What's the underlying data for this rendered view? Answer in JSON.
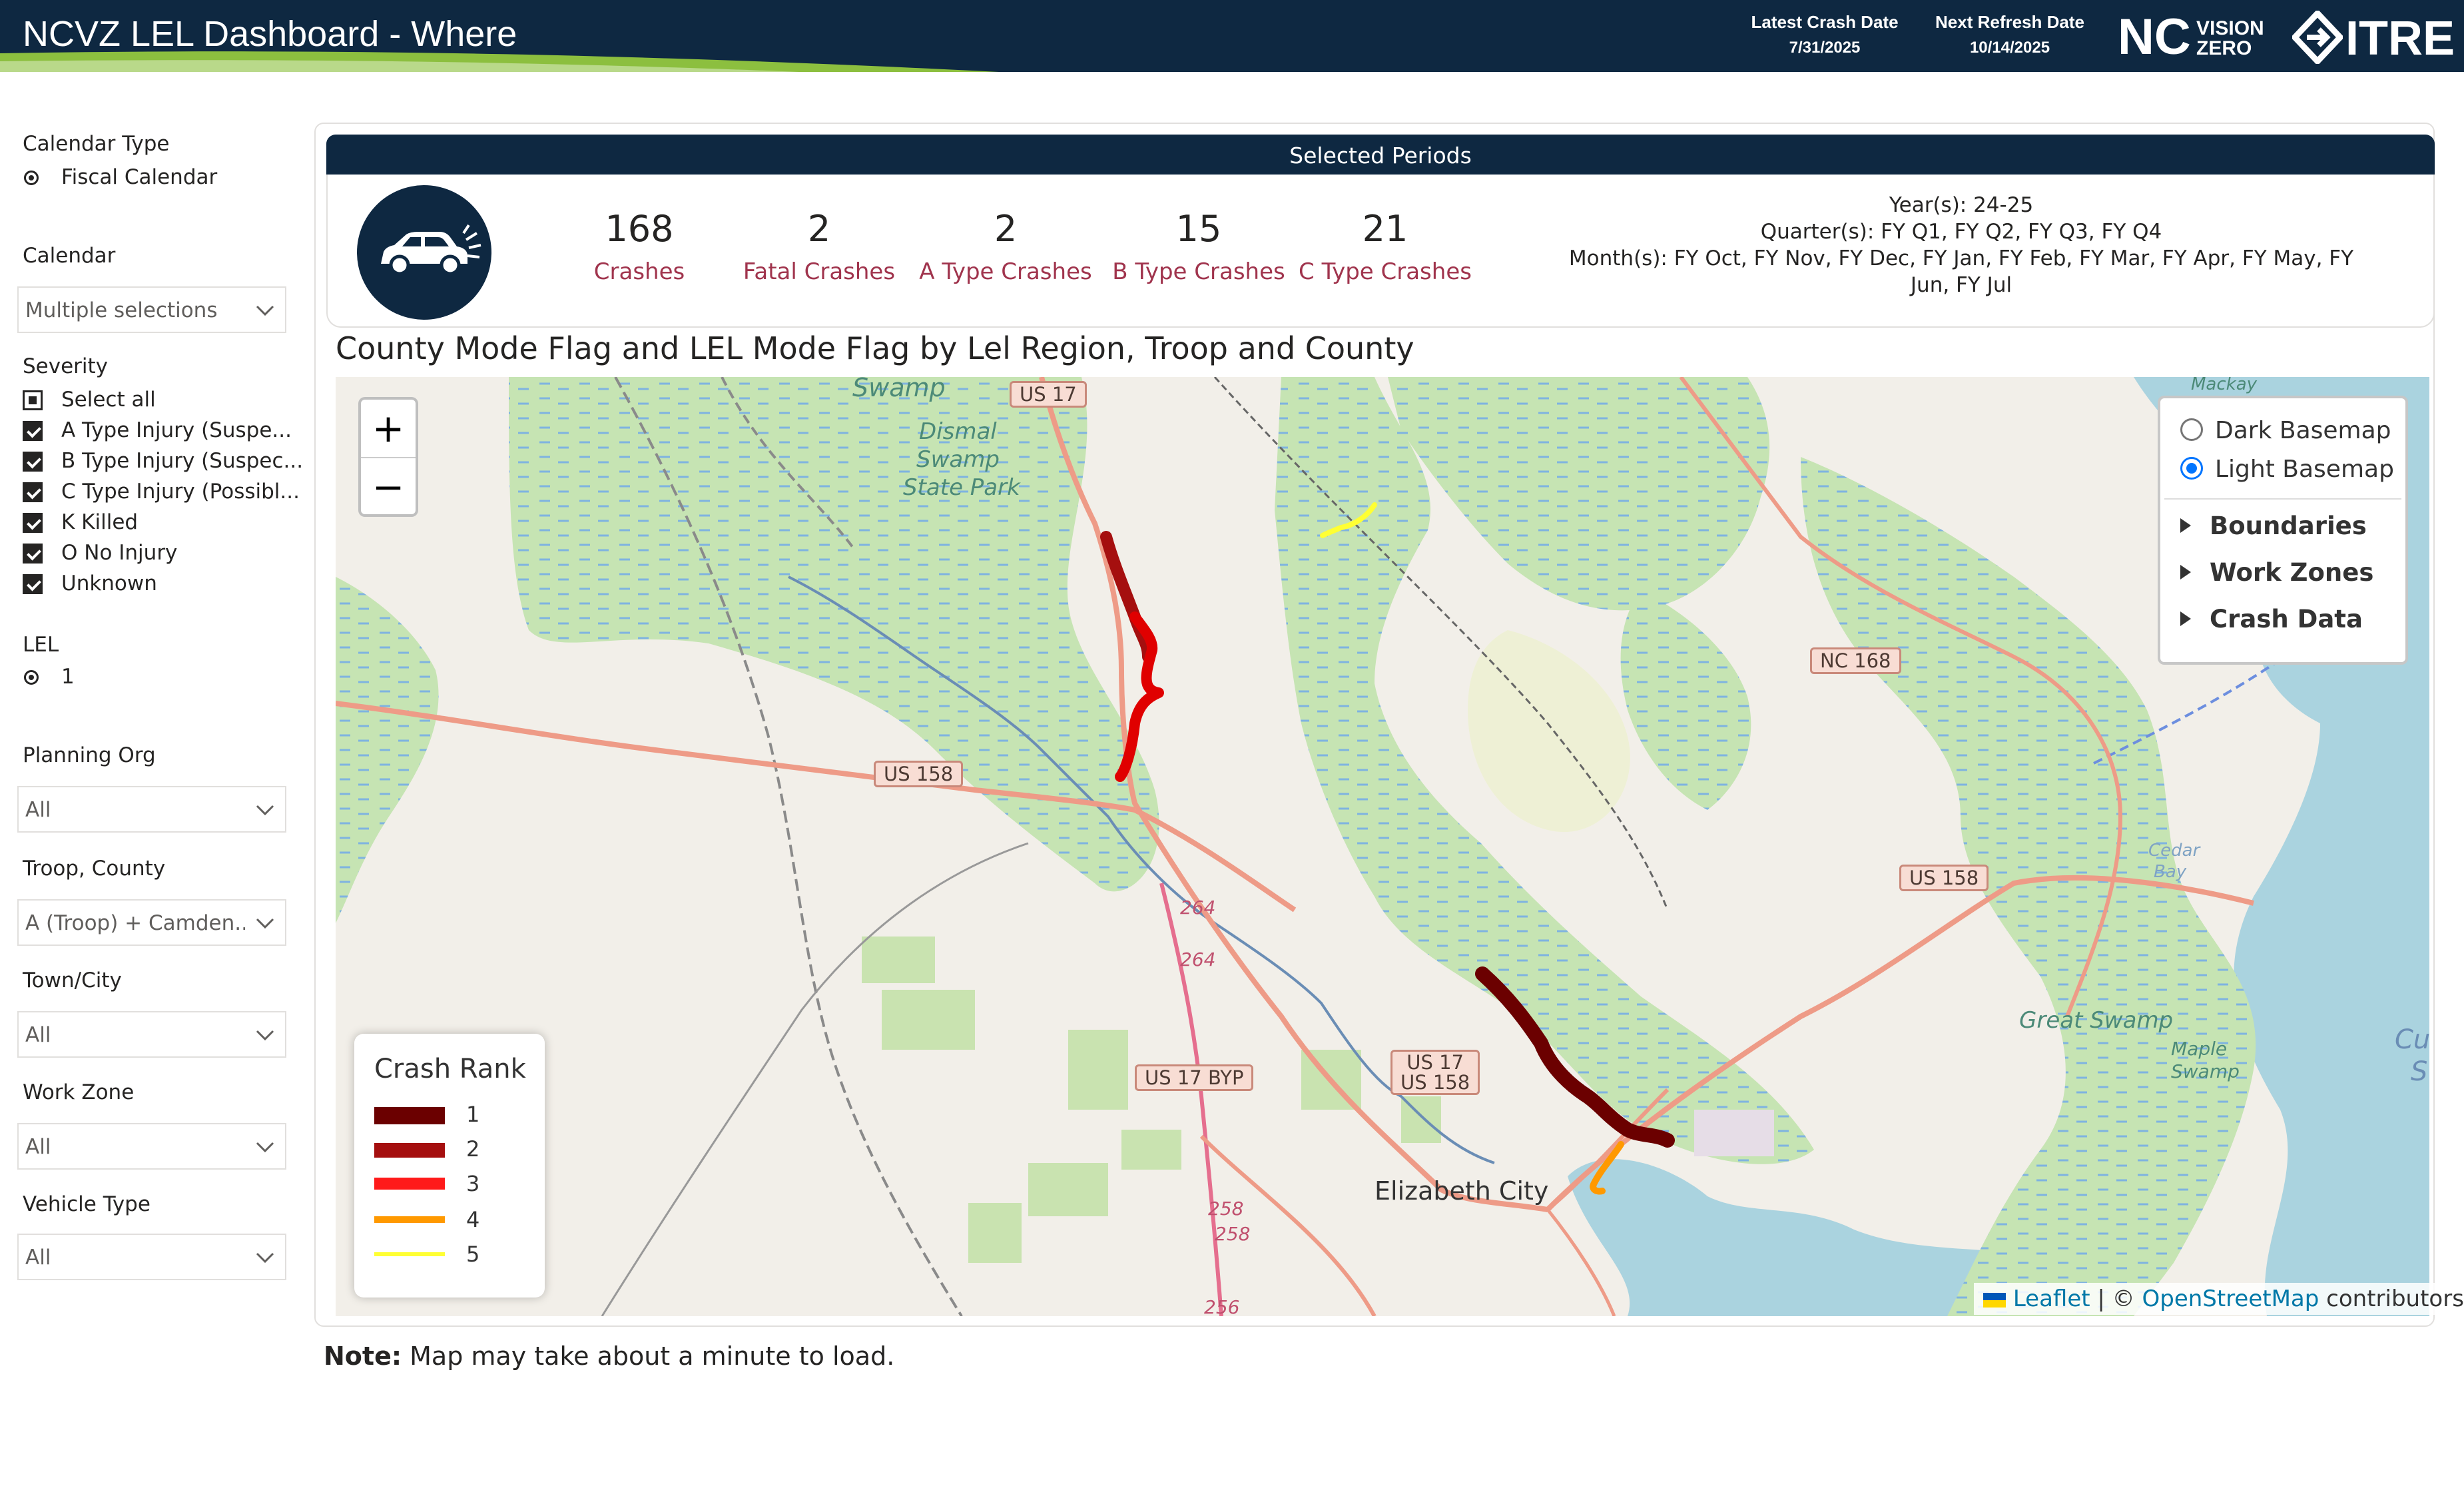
{
  "header": {
    "title": "NCVZ LEL Dashboard - Where",
    "latest_crash_label": "Latest Crash Date",
    "latest_crash_value": "7/31/2025",
    "next_refresh_label": "Next Refresh Date",
    "next_refresh_value": "10/14/2025",
    "logo_nc": "NC",
    "logo_vision": "VISION",
    "logo_zero": "ZERO",
    "logo_itre": "ITRE",
    "colors": {
      "bg": "#0e2841",
      "accent_green": "#8cbf3f"
    }
  },
  "filters": {
    "calendar_type": {
      "label": "Calendar Type",
      "options": [
        "Fiscal Calendar"
      ],
      "selected": "Fiscal Calendar"
    },
    "calendar": {
      "label": "Calendar",
      "value": "Multiple selections"
    },
    "severity": {
      "label": "Severity",
      "select_all": "Select all",
      "items": [
        {
          "label": "A Type Injury (Suspe...",
          "checked": true
        },
        {
          "label": "B Type Injury (Suspec...",
          "checked": true
        },
        {
          "label": "C Type Injury (Possibl...",
          "checked": true
        },
        {
          "label": "K Killed",
          "checked": true
        },
        {
          "label": "O No Injury",
          "checked": true
        },
        {
          "label": "Unknown",
          "checked": true
        }
      ]
    },
    "lel": {
      "label": "LEL",
      "options": [
        "1"
      ],
      "selected": "1"
    },
    "planning_org": {
      "label": "Planning Org",
      "value": "All"
    },
    "troop_county": {
      "label": "Troop, County",
      "value": "A (Troop) + Camden..."
    },
    "town_city": {
      "label": "Town/City",
      "value": "All"
    },
    "work_zone": {
      "label": "Work Zone",
      "value": "All"
    },
    "vehicle_type": {
      "label": "Vehicle Type",
      "value": "All"
    }
  },
  "summary": {
    "title": "Selected Periods",
    "icon": "car-crash-icon",
    "kpis": [
      {
        "value": "168",
        "label": "Crashes"
      },
      {
        "value": "2",
        "label": "Fatal Crashes"
      },
      {
        "value": "2",
        "label": "A Type Crashes"
      },
      {
        "value": "15",
        "label": "B Type Crashes"
      },
      {
        "value": "21",
        "label": "C Type Crashes"
      }
    ],
    "periods": {
      "years": "Year(s): 24-25",
      "quarters": "Quarter(s): FY Q1, FY Q2, FY Q3, FY Q4",
      "months_line1": "Month(s): FY Oct, FY Nov, FY Dec, FY Jan, FY Feb, FY Mar, FY Apr, FY May, FY",
      "months_line2": "Jun, FY Jul"
    }
  },
  "map": {
    "title": "County Mode Flag and LEL Mode Flag by Lel Region, Troop and County",
    "zoom_in": "+",
    "zoom_out": "−",
    "road_labels": [
      "US 17",
      "US 158",
      "NC 168",
      "US 158",
      "US 17 BYP",
      "US 17",
      "US 158"
    ],
    "route_numbers": [
      "264",
      "264",
      "258",
      "258",
      "256"
    ],
    "places": {
      "swamp_top": "Swamp",
      "dismal": "Dismal",
      "swamp": "Swamp",
      "state_park": "State Park",
      "great_swamp": "Great Swamp",
      "maple": "Maple",
      "maple_swamp": "Swamp",
      "cedar": "Cedar",
      "bay": "Bay",
      "mackay": "Mackay",
      "city": "Elizabeth City",
      "edge_c": "Cu",
      "edge_s": "S"
    },
    "layers": {
      "basemaps": [
        {
          "label": "Dark Basemap",
          "selected": false
        },
        {
          "label": "Light Basemap",
          "selected": true
        }
      ],
      "groups": [
        "Boundaries",
        "Work Zones",
        "Crash Data"
      ]
    },
    "legend": {
      "title": "Crash Rank",
      "items": [
        {
          "rank": "1",
          "color": "#6b0000"
        },
        {
          "rank": "2",
          "color": "#a50f0f"
        },
        {
          "rank": "3",
          "color": "#ff1a1a"
        },
        {
          "rank": "4",
          "color": "#ff9900"
        },
        {
          "rank": "5",
          "color": "#ffff33"
        }
      ]
    },
    "attribution": {
      "leaflet": "Leaflet",
      "sep": " | © ",
      "osm": "OpenStreetMap",
      "tail": " contributors"
    }
  },
  "note": {
    "bold": "Note:",
    "text": " Map may take about a minute to load."
  }
}
